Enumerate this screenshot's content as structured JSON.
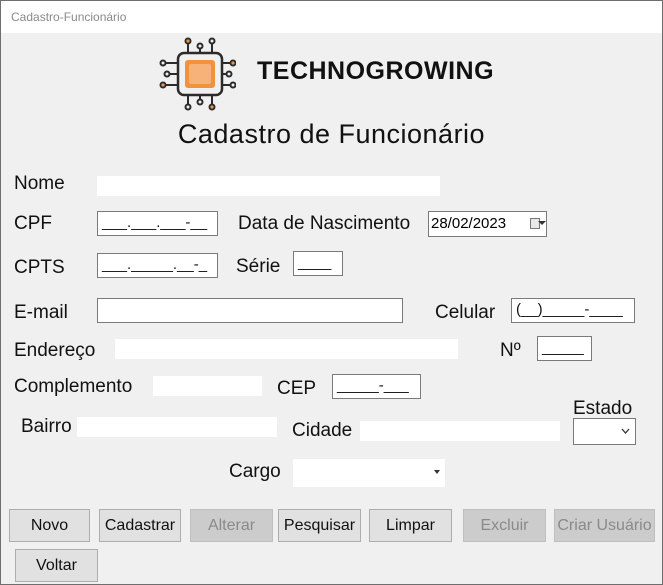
{
  "window": {
    "title": "Cadastro-Funcionário"
  },
  "header": {
    "brand": "TECHNOGROWING",
    "title": "Cadastro de Funcionário"
  },
  "labels": {
    "nome": "Nome",
    "cpf": "CPF",
    "data_nascimento": "Data de Nascimento",
    "cpts": "CPTS",
    "serie": "Série",
    "email": "E-mail",
    "celular": "Celular",
    "endereco": "Endereço",
    "numero": "Nº",
    "complemento": "Complemento",
    "cep": "CEP",
    "estado": "Estado",
    "bairro": "Bairro",
    "cidade": "Cidade",
    "cargo": "Cargo"
  },
  "fields": {
    "cpf_mask": "___.___.___-__",
    "data_nascimento": "28/02/2023",
    "cpts_mask": "___._____.__-_",
    "serie_mask": "____",
    "celular_mask": "(__)_____-____",
    "numero_mask": "_____",
    "cep_mask": "_____-___"
  },
  "buttons": {
    "novo": "Novo",
    "cadastrar": "Cadastrar",
    "alterar": "Alterar",
    "pesquisar": "Pesquisar",
    "limpar": "Limpar",
    "excluir": "Excluir",
    "criar_usuario": "Criar Usuário",
    "voltar": "Voltar"
  },
  "colors": {
    "logo_orange": "#f3923e",
    "logo_dark": "#2b2b2b",
    "disabled_text": "#8a8a8a"
  }
}
